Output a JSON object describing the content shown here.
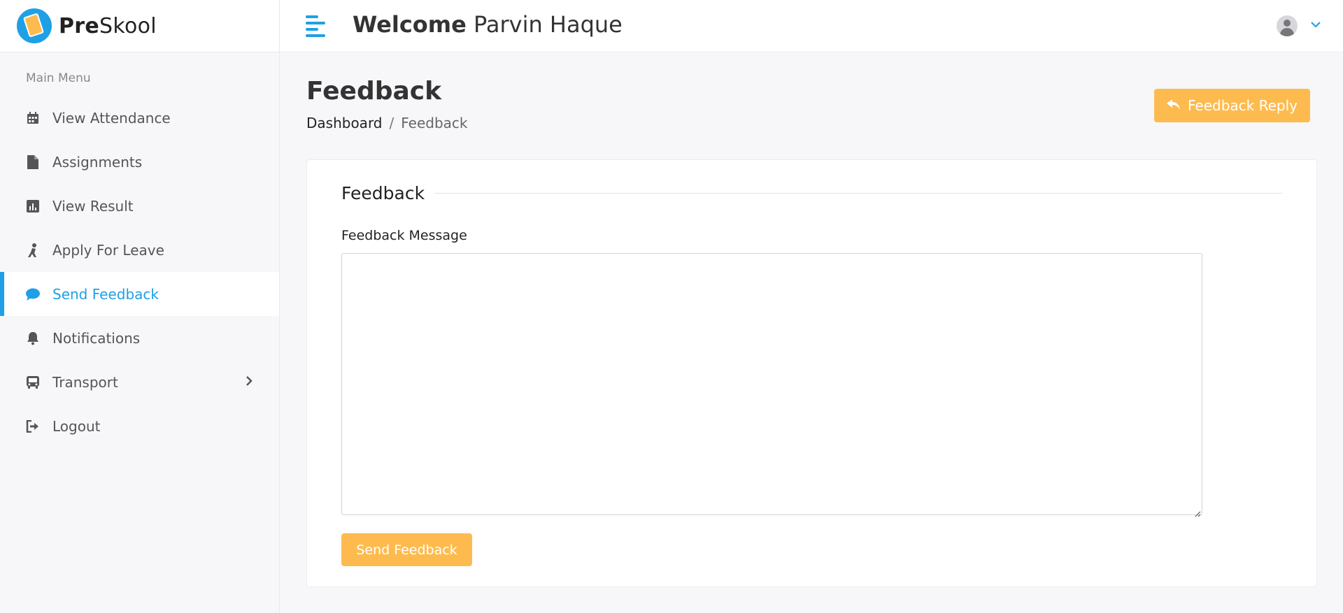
{
  "brand": {
    "name_bold": "Pre",
    "name_rest": "Skool"
  },
  "header": {
    "welcome_bold": "Welcome",
    "user_name": "Parvin Haque"
  },
  "sidebar": {
    "title": "Main Menu",
    "items": [
      {
        "label": "View Attendance",
        "icon": "calendar-icon"
      },
      {
        "label": "Assignments",
        "icon": "file-icon"
      },
      {
        "label": "View Result",
        "icon": "chart-icon"
      },
      {
        "label": "Apply For Leave",
        "icon": "person-icon"
      },
      {
        "label": "Send Feedback",
        "icon": "comment-icon",
        "active": true
      },
      {
        "label": "Notifications",
        "icon": "bell-icon"
      },
      {
        "label": "Transport",
        "icon": "bus-icon",
        "has_submenu": true
      },
      {
        "label": "Logout",
        "icon": "logout-icon"
      }
    ]
  },
  "page": {
    "title": "Feedback",
    "breadcrumb": [
      "Dashboard",
      "Feedback"
    ],
    "reply_button": "Feedback Reply"
  },
  "form": {
    "section_title": "Feedback",
    "message_label": "Feedback Message",
    "message_value": "",
    "submit_label": "Send Feedback"
  },
  "colors": {
    "accent": "#1fa0e6",
    "button": "#fdbb4f"
  }
}
